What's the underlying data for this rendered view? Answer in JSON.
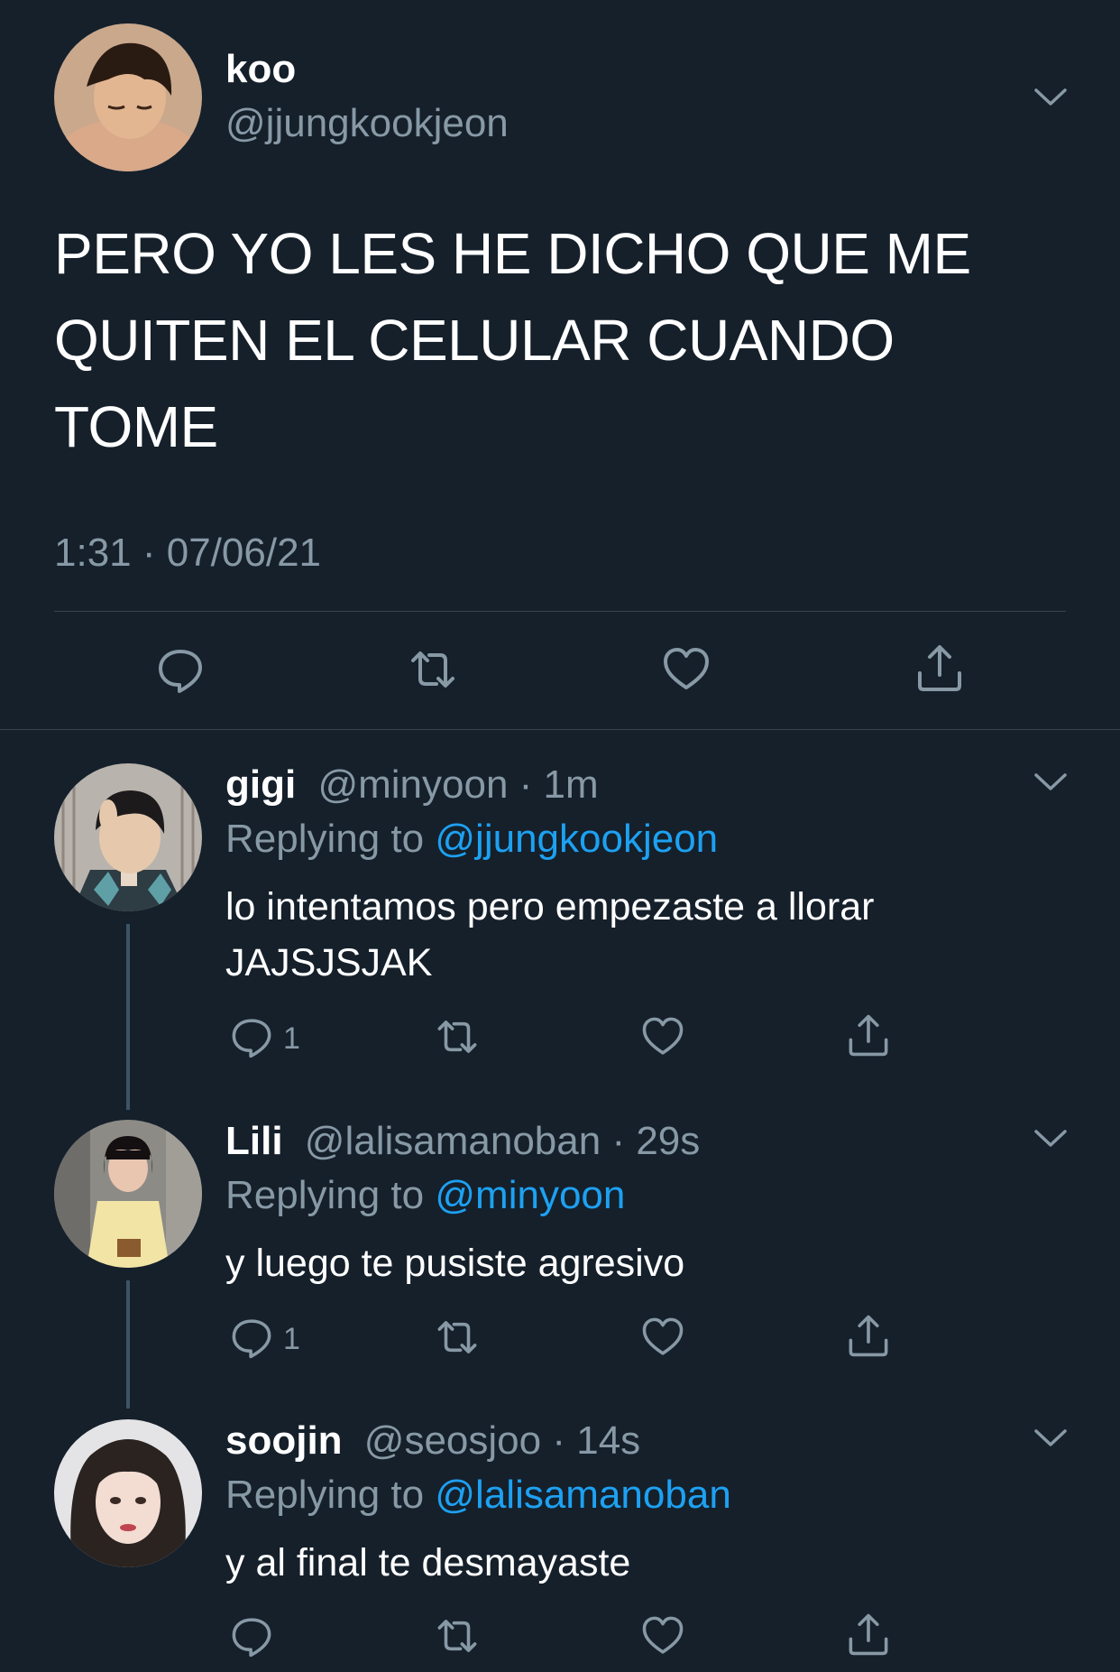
{
  "main_tweet": {
    "name": "koo",
    "handle": "@jjungkookjeon",
    "text": "PERO YO LES HE DICHO QUE ME QUITEN EL CELULAR CUANDO TOME",
    "timestamp": "1:31 · 07/06/21",
    "actions": [
      "reply-icon",
      "retweet-icon",
      "like-icon",
      "share-icon"
    ]
  },
  "replies": [
    {
      "name": "gigi",
      "handle": "@minyoon",
      "time": "1m",
      "replying_label": "Replying to",
      "replying_to": "@jjungkookjeon",
      "text": "lo intentamos pero empezaste a llorar JAJSJSJAK",
      "reply_count": "1"
    },
    {
      "name": "Lili",
      "handle": "@lalisamanoban",
      "time": "29s",
      "replying_label": "Replying to",
      "replying_to": "@minyoon",
      "text": "y luego te pusiste agresivo",
      "reply_count": "1"
    },
    {
      "name": "soojin",
      "handle": "@seosjoo",
      "time": "14s",
      "replying_label": "Replying to",
      "replying_to": "@lalisamanoban",
      "text": "y al final te desmayaste",
      "reply_count": ""
    }
  ],
  "separator": " · ",
  "colors": {
    "background": "#15202b",
    "secondary_text": "#8899a6",
    "link": "#1da1f2",
    "divider": "#38444d"
  }
}
